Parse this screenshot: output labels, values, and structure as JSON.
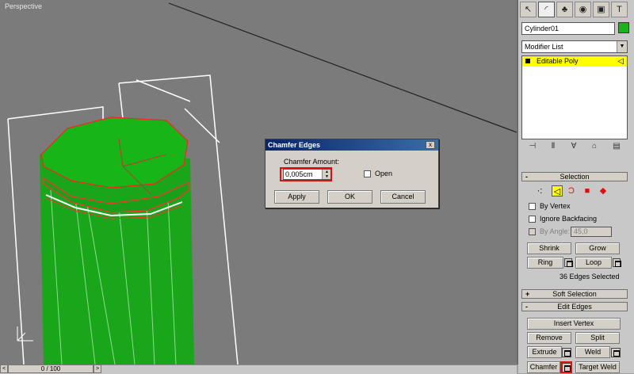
{
  "viewport": {
    "label": "Perspective"
  },
  "timeslider": {
    "frame": "0 / 100",
    "left_arrow": "<",
    "right_arrow": ">"
  },
  "panel": {
    "tabs": [
      {
        "name": "create-tab",
        "glyph": "↖"
      },
      {
        "name": "modify-tab",
        "glyph": "◜"
      },
      {
        "name": "hierarchy-tab",
        "glyph": "♣"
      },
      {
        "name": "motion-tab",
        "glyph": "◉"
      },
      {
        "name": "display-tab",
        "glyph": "▣"
      },
      {
        "name": "utilities-tab",
        "glyph": "T"
      }
    ],
    "object_name": "Cylinder01",
    "object_color": "#1bb31b",
    "modifier_list": "Modifier List",
    "stack_item": "Editable Poly",
    "selection": {
      "title": "Selection",
      "by_vertex": "By Vertex",
      "ignore_backfacing": "Ignore Backfacing",
      "by_angle": "By Angle:",
      "angle_value": "45,0",
      "shrink": "Shrink",
      "grow": "Grow",
      "ring": "Ring",
      "loop": "Loop",
      "status": "36 Edges Selected"
    },
    "soft_selection": {
      "title": "Soft Selection",
      "pm": "+"
    },
    "edit_edges": {
      "title": "Edit Edges",
      "insert_vertex": "Insert Vertex",
      "remove": "Remove",
      "split": "Split",
      "extrude": "Extrude",
      "weld": "Weld",
      "chamfer": "Chamfer",
      "target_weld": "Target Weld"
    },
    "minus": "-"
  },
  "dialog": {
    "title": "Chamfer Edges",
    "close": "x",
    "amount_label": "Chamfer Amount:",
    "amount_value": "0,005cm",
    "open_label": "Open",
    "apply": "Apply",
    "ok": "OK",
    "cancel": "Cancel"
  },
  "colors": {
    "accent": "#e01010",
    "stack_highlight": "#ffff00",
    "cylinder": "#1bb31b"
  }
}
